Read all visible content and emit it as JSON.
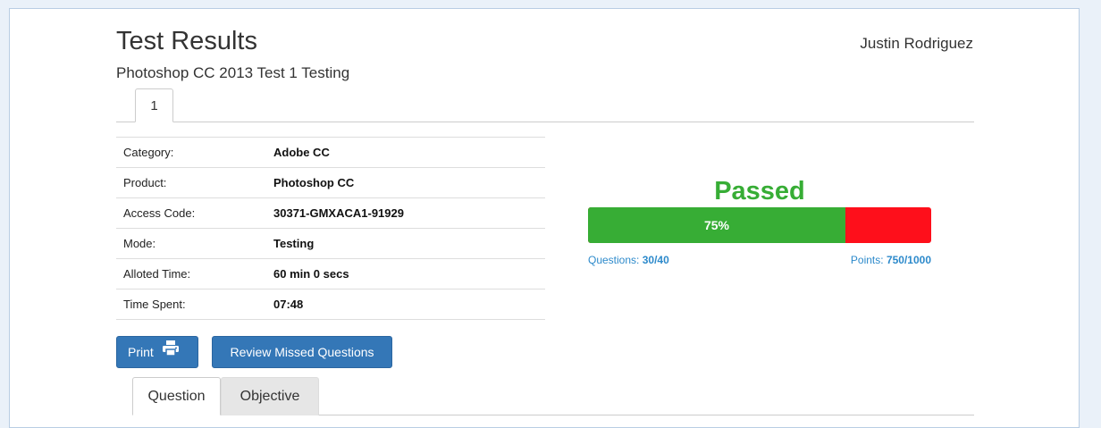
{
  "header": {
    "title": "Test Results",
    "user_name": "Justin Rodriguez",
    "subtitle": "Photoshop CC 2013 Test 1 Testing"
  },
  "top_tabs": [
    {
      "label": "1",
      "active": true
    }
  ],
  "info_rows": [
    {
      "label": "Category:",
      "value": "Adobe CC"
    },
    {
      "label": "Product:",
      "value": "Photoshop CC"
    },
    {
      "label": "Access Code:",
      "value": "30371-GMXACA1-91929"
    },
    {
      "label": "Mode:",
      "value": "Testing"
    },
    {
      "label": "Alloted Time:",
      "value": "60 min 0 secs"
    },
    {
      "label": "Time Spent:",
      "value": "07:48"
    }
  ],
  "result": {
    "status": "Passed",
    "percent_label": "75%",
    "percent": 0.75,
    "questions_label": "Questions:",
    "questions_value": "30/40",
    "points_label": "Points:",
    "points_value": "750/1000",
    "colors": {
      "pass": "#37ad35",
      "fail": "#fe0f1b",
      "link": "#2d8acb"
    }
  },
  "buttons": {
    "print_label": "Print",
    "review_label": "Review Missed Questions",
    "print_icon": "printer-icon"
  },
  "bottom_tabs": [
    {
      "label": "Question",
      "active": true
    },
    {
      "label": "Objective",
      "active": false
    }
  ],
  "colors": {
    "button": "#3477b7",
    "page_bg": "#eaf1f9"
  }
}
